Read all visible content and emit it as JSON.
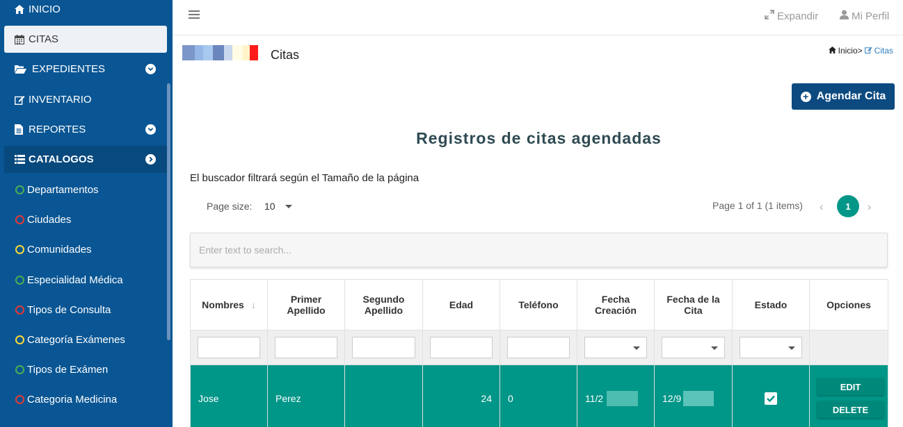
{
  "sidebar": {
    "items": [
      {
        "label": "INICIO",
        "icon": "home-icon"
      },
      {
        "label": "CITAS",
        "icon": "calendar-icon"
      },
      {
        "label": "EXPEDIENTES",
        "icon": "folder-open-icon"
      },
      {
        "label": "INVENTARIO",
        "icon": "edit-icon"
      },
      {
        "label": "REPORTES",
        "icon": "file-icon"
      },
      {
        "label": "CATALOGOS",
        "icon": "list-icon"
      }
    ],
    "sub_items": [
      {
        "label": "Departamentos",
        "color": "#4caf50"
      },
      {
        "label": "Ciudades",
        "color": "#e53935"
      },
      {
        "label": "Comunidades",
        "color": "#fdd835"
      },
      {
        "label": "Especialidad Médica",
        "color": "#4caf50"
      },
      {
        "label": "Tipos de Consulta",
        "color": "#e53935"
      },
      {
        "label": "Categoría Exámenes",
        "color": "#fdd835"
      },
      {
        "label": "Tipos de Exámen",
        "color": "#4caf50"
      },
      {
        "label": "Categoria Medicina",
        "color": "#e53935"
      }
    ]
  },
  "topbar": {
    "expand_label": "Expandir",
    "profile_label": "Mi Perfil"
  },
  "page": {
    "title": "Citas",
    "breadcrumb_home": "Inicio>",
    "breadcrumb_current": "Citas",
    "add_button": "Agendar Cita",
    "heading": "Registros de citas agendadas",
    "hint": "El buscador filtrará según el Tamaño de la página"
  },
  "pager": {
    "size_label": "Page size:",
    "size_value": "10",
    "info": "Page 1 of 1 (1 items)",
    "current": "1"
  },
  "search": {
    "placeholder": "Enter text to search..."
  },
  "table": {
    "columns": [
      "Nombres",
      "Primer Apellido",
      "Segundo Apellido",
      "Edad",
      "Teléfono",
      "Fecha Creación",
      "Fecha de la Cita",
      "Estado",
      "Opciones"
    ],
    "rows": [
      {
        "nombres": "Jose",
        "primer_apellido": "Perez",
        "segundo_apellido": "",
        "edad": "24",
        "telefono": "0",
        "fecha_creacion": "11/2",
        "fecha_cita": "12/9",
        "estado_checked": true,
        "edit_label": "EDIT",
        "delete_label": "DELETE"
      }
    ]
  },
  "colors": {
    "sidebar_bg": "#0a5694",
    "accent_teal": "#009688",
    "button_blue": "#0c4a80"
  }
}
